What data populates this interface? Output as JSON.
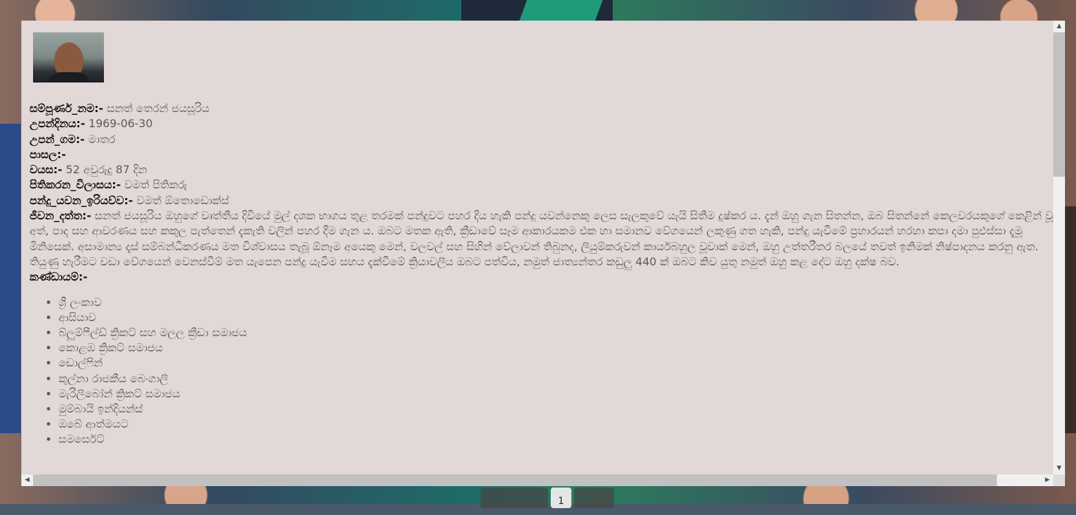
{
  "profile": {
    "fields": [
      {
        "label": "සම්පූර්ණ_නම:-",
        "value": " සනත් තෙරන් ජයසූරිය"
      },
      {
        "label": "උපන්දිනය:-",
        "value": " 1969-06-30"
      },
      {
        "label": "උපන්_ගම:-",
        "value": " මාතර"
      },
      {
        "label": "පාසල:-",
        "value": ""
      },
      {
        "label": "වයස:-",
        "value": " 52 අවුරුදු 87 දින"
      },
      {
        "label": "පිතිකරන_විලාසය:-",
        "value": " වමත් පිතිකරු"
      },
      {
        "label": "පන්දු_යවන_ඉරියව්ව:-",
        "value": " වමත් ඕතොඩොක්ස්"
      }
    ],
    "bio_label": "ජීවන_දත්ත:-",
    "bio_text": " සනත් ජයසූරිය ඔහුගේ වෘත්තීය දිවියේ මුල් දශක භාගය තුළ තරමක් පන්දුවට පහර දිය හැකි පන්දු යවන්නෙකු ලෙස සැලකුවේ යැයි සිතීම දුෂ්කර ය. දැන් ඔහු ගැන සිතන්න, ඔබ සිතන්නේ කෙලවරයකුගේ කෙළින් වූ අත්, පාද සහ ආවරණය සහ කකුල පැත්තෙන් දැකැති වලින් පහර දීම ගැන ය. ඔබට මතක ඇති, ක්‍රීඩාවේ සෑම ආකාරයකම එක හා සමානව වේගයෙන් ලකුණු ගත හැකි, පන්දු යැවීමේ ප්‍රහාරයන් හරහා කපා දමා පුළුස්සා දැමූ මිනිසෙක්. අසාමාන්‍ය දෑස් සම්බන්ධීකරණය මත විශ්වාසය තැබූ ඕනෑම අයෙකු මෙන්, වලවල් සහ සිහින් වේලාවන් තිබුනද, ලියුම්කරුවන් කාර්යබහුල වූවාක් මෙන්, ඔහු උත්තරීතර බලයේ තවත් ඉනිමක් නිෂ්පාදනය කරනු ඇත. තියුණු හැරීමට වඩා වේගයෙන් වෙනස්වීම් මත යැපෙන පන්දු යැවීම සහය දැක්වීමේ ක්‍රියාවලිය ඔබට පත්විය, නමුත් ජාත්‍යන්තර කඩුලු 440 ක් ඔබට කිව යුතු නමුත් ඔහු කළ දේට ඔහු දක්ෂ බව.",
    "teams_label": "කණ්ඩායම්:-",
    "teams": [
      "ශ්‍රී ලංකාව",
      "ආසියාව",
      "බ්ලූම්ෆීල්ඩ් ක්‍රිකට් සහ මලල ක්‍රීඩා සමාජය",
      "කොළඹ ක්‍රිකට් සමාජය",
      "ඩොල්ෆින්",
      "කුල්නා රාජකීය බෙංගාලි",
      "මැරිලිබෝන් ක්‍රිකට් සමාජය",
      "මුම්බායි ඉන්දියන්ස්",
      "ඔබේ ආත්මයට",
      "සමර්සෙට්"
    ]
  },
  "pagination": {
    "current_page": "1"
  }
}
